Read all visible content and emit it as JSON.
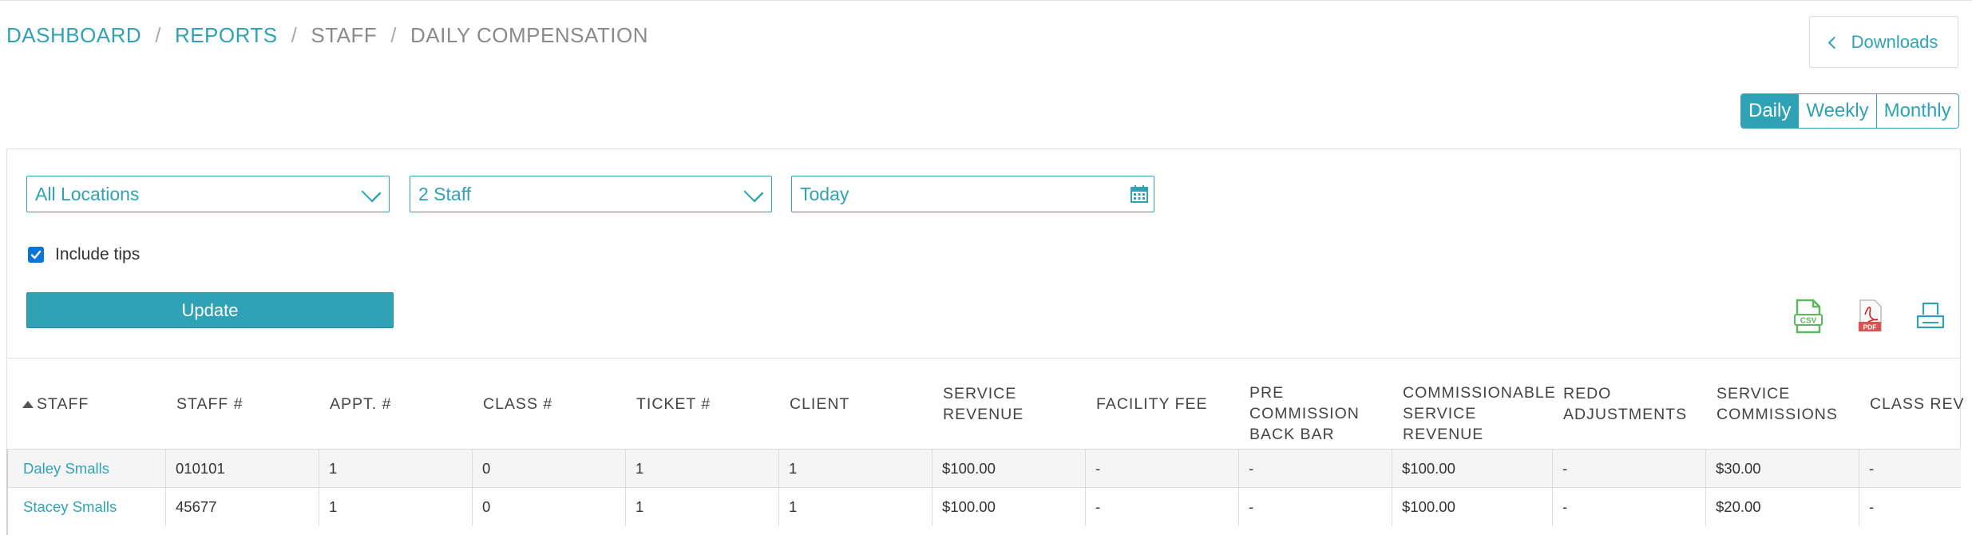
{
  "breadcrumb": {
    "items": [
      {
        "label": "DASHBOARD",
        "link": true
      },
      {
        "label": "REPORTS",
        "link": true
      },
      {
        "label": "STAFF",
        "link": false
      },
      {
        "label": "DAILY COMPENSATION",
        "link": false
      }
    ],
    "separator": "/"
  },
  "downloads": {
    "label": "Downloads"
  },
  "period": {
    "options": [
      "Daily",
      "Weekly",
      "Monthly"
    ],
    "selected": "Daily"
  },
  "filters": {
    "location": "All Locations",
    "staff": "2 Staff",
    "date": "Today"
  },
  "include_tips": {
    "label": "Include tips",
    "checked": true
  },
  "update_button": {
    "label": "Update"
  },
  "export_icons": [
    "csv-icon",
    "pdf-icon",
    "print-icon"
  ],
  "table": {
    "columns": [
      {
        "key": "staff",
        "label": "STAFF",
        "lines": [
          "STAFF"
        ],
        "sorted": "asc"
      },
      {
        "key": "staff_no",
        "label": "STAFF #",
        "lines": [
          "STAFF #"
        ]
      },
      {
        "key": "appt_no",
        "label": "APPT. #",
        "lines": [
          "APPT. #"
        ]
      },
      {
        "key": "class_no",
        "label": "CLASS #",
        "lines": [
          "CLASS #"
        ]
      },
      {
        "key": "ticket_no",
        "label": "TICKET #",
        "lines": [
          "TICKET #"
        ]
      },
      {
        "key": "client",
        "label": "CLIENT",
        "lines": [
          "CLIENT"
        ]
      },
      {
        "key": "service_revenue",
        "label": "SERVICE REVENUE",
        "lines": [
          "SERVICE",
          "REVENUE"
        ]
      },
      {
        "key": "facility_fee",
        "label": "FACILITY FEE",
        "lines": [
          "FACILITY FEE"
        ]
      },
      {
        "key": "pre_commission_back_bar",
        "label": "PRE COMMISSION BACK BAR",
        "lines": [
          "PRE",
          "COMMISSION",
          "BACK BAR"
        ]
      },
      {
        "key": "commissionable_service_revenue",
        "label": "COMMISSIONABLE SERVICE REVENUE",
        "lines": [
          "COMMISSIONABLE",
          "SERVICE",
          "REVENUE"
        ]
      },
      {
        "key": "redo_adjustments",
        "label": "REDO ADJUSTMENTS",
        "lines": [
          "REDO",
          "ADJUSTMENTS"
        ]
      },
      {
        "key": "service_commissions",
        "label": "SERVICE COMMISSIONS",
        "lines": [
          "SERVICE",
          "COMMISSIONS"
        ]
      },
      {
        "key": "class_rev",
        "label": "CLASS REV",
        "lines": [
          "CLASS REV"
        ]
      }
    ],
    "rows": [
      {
        "staff": "Daley Smalls",
        "staff_no": "010101",
        "appt_no": "1",
        "class_no": "0",
        "ticket_no": "1",
        "client": "1",
        "service_revenue": "$100.00",
        "facility_fee": "-",
        "pre_commission_back_bar": "-",
        "commissionable_service_revenue": "$100.00",
        "redo_adjustments": "-",
        "service_commissions": "$30.00",
        "class_rev": "-"
      },
      {
        "staff": "Stacey Smalls",
        "staff_no": "45677",
        "appt_no": "1",
        "class_no": "0",
        "ticket_no": "1",
        "client": "1",
        "service_revenue": "$100.00",
        "facility_fee": "-",
        "pre_commission_back_bar": "-",
        "commissionable_service_revenue": "$100.00",
        "redo_adjustments": "-",
        "service_commissions": "$20.00",
        "class_rev": "-"
      }
    ]
  },
  "colors": {
    "accent": "#2fa3b5",
    "checkbox": "#0b75d9",
    "csv": "#5cb85c",
    "pdf": "#d9534f"
  }
}
